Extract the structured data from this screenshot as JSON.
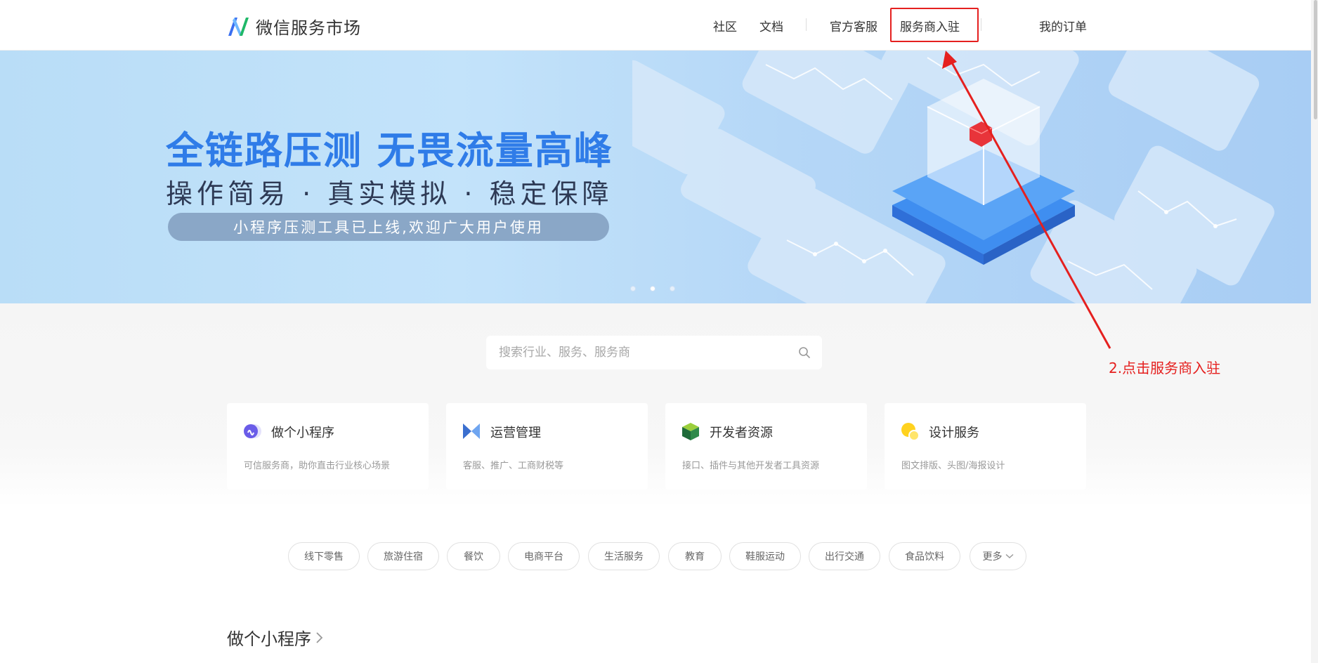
{
  "header": {
    "logo_text": "微信服务市场",
    "nav": {
      "community": "社区",
      "docs": "文档",
      "support": "官方客服",
      "merchant_join": "服务商入驻",
      "my_orders": "我的订单"
    }
  },
  "banner": {
    "title": "全链路压测  无畏流量高峰",
    "subtitle": "操作简易 · 真实模拟 · 稳定保障",
    "pill": "小程序压测工具已上线,欢迎广大用户使用",
    "slides": 3,
    "active_slide": 2
  },
  "search": {
    "placeholder": "搜索行业、服务、服务商",
    "value": ""
  },
  "cards": [
    {
      "title": "做个小程序",
      "desc": "可信服务商，助你直击行业核心场景",
      "icon": "mini-program-icon"
    },
    {
      "title": "运营管理",
      "desc": "客服、推广、工商财税等",
      "icon": "operations-icon"
    },
    {
      "title": "开发者资源",
      "desc": "接口、插件与其他开发者工具资源",
      "icon": "developer-cube-icon"
    },
    {
      "title": "设计服务",
      "desc": "图文排版、头图/海报设计",
      "icon": "design-circles-icon"
    }
  ],
  "tags": [
    "线下零售",
    "旅游住宿",
    "餐饮",
    "电商平台",
    "生活服务",
    "教育",
    "鞋服运动",
    "出行交通",
    "食品饮料",
    "更多"
  ],
  "section": {
    "title": "做个小程序"
  },
  "annotation": {
    "text": "2.点击服务商入驻",
    "color": "#e5201f"
  },
  "colors": {
    "brand_blue": "#2f7ce8",
    "annotation_red": "#e5201f"
  }
}
